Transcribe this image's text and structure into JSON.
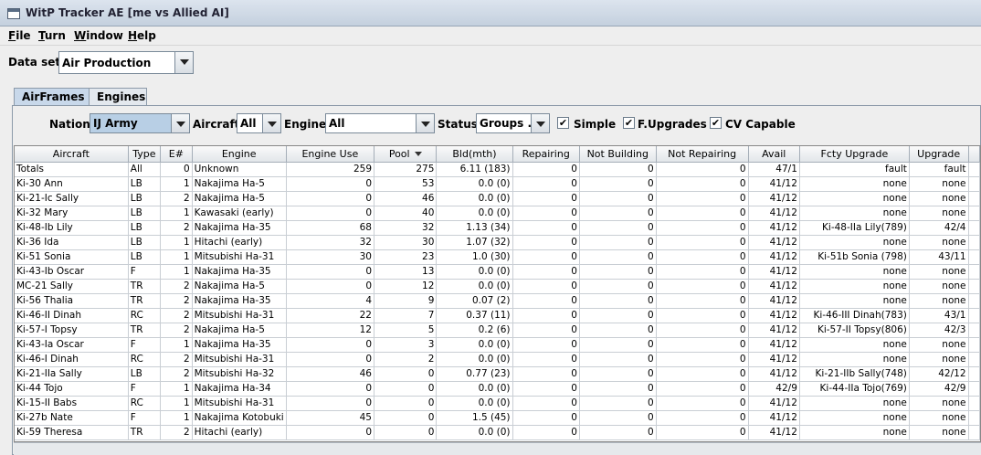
{
  "window": {
    "title": "WitP Tracker AE [me vs Allied AI]"
  },
  "menu": [
    "File",
    "Turn",
    "Window",
    "Help"
  ],
  "dataset": {
    "label": "Data set:",
    "value": "Air Production"
  },
  "tabs": [
    "AirFrames",
    "Engines"
  ],
  "filters": {
    "nation_label": "Nation:",
    "nation_value": "IJ Army",
    "aircraft_label": "Aircraft:",
    "aircraft_value": "All",
    "engine_label": "Engine:",
    "engine_value": "All",
    "status_label": "Status:",
    "status_value": "Groups ...",
    "simple_label": "Simple",
    "fupgrades_label": "F.Upgrades",
    "cv_label": "CV Capable",
    "check_glyph": "✔"
  },
  "table": {
    "columns": [
      "Aircraft",
      "Type",
      "E#",
      "Engine",
      "Engine Use",
      "Pool",
      "Bld(mth)",
      "Repairing",
      "Not Building",
      "Not Repairing",
      "Avail",
      "Fcty Upgrade",
      "Upgrade"
    ],
    "sorted_column": "Pool",
    "rows": [
      [
        "Totals",
        "All",
        "0",
        "Unknown",
        "259",
        "275",
        "6.11 (183)",
        "0",
        "0",
        "0",
        "47/1",
        "fault",
        "fault"
      ],
      [
        "Ki-30 Ann",
        "LB",
        "1",
        "Nakajima Ha-5",
        "0",
        "53",
        "0.0 (0)",
        "0",
        "0",
        "0",
        "41/12",
        "none",
        "none"
      ],
      [
        "Ki-21-Ic Sally",
        "LB",
        "2",
        "Nakajima Ha-5",
        "0",
        "46",
        "0.0 (0)",
        "0",
        "0",
        "0",
        "41/12",
        "none",
        "none"
      ],
      [
        "Ki-32 Mary",
        "LB",
        "1",
        "Kawasaki (early)",
        "0",
        "40",
        "0.0 (0)",
        "0",
        "0",
        "0",
        "41/12",
        "none",
        "none"
      ],
      [
        "Ki-48-Ib Lily",
        "LB",
        "2",
        "Nakajima Ha-35",
        "68",
        "32",
        "1.13 (34)",
        "0",
        "0",
        "0",
        "41/12",
        "Ki-48-IIa Lily(789)",
        "42/4"
      ],
      [
        "Ki-36 Ida",
        "LB",
        "1",
        "Hitachi (early)",
        "32",
        "30",
        "1.07 (32)",
        "0",
        "0",
        "0",
        "41/12",
        "none",
        "none"
      ],
      [
        "Ki-51 Sonia",
        "LB",
        "1",
        "Mitsubishi Ha-31",
        "30",
        "23",
        "1.0 (30)",
        "0",
        "0",
        "0",
        "41/12",
        "Ki-51b Sonia (798)",
        "43/11"
      ],
      [
        "Ki-43-Ib Oscar",
        "F",
        "1",
        "Nakajima Ha-35",
        "0",
        "13",
        "0.0 (0)",
        "0",
        "0",
        "0",
        "41/12",
        "none",
        "none"
      ],
      [
        "MC-21 Sally",
        "TR",
        "2",
        "Nakajima Ha-5",
        "0",
        "12",
        "0.0 (0)",
        "0",
        "0",
        "0",
        "41/12",
        "none",
        "none"
      ],
      [
        "Ki-56 Thalia",
        "TR",
        "2",
        "Nakajima Ha-35",
        "4",
        "9",
        "0.07 (2)",
        "0",
        "0",
        "0",
        "41/12",
        "none",
        "none"
      ],
      [
        "Ki-46-II Dinah",
        "RC",
        "2",
        "Mitsubishi Ha-31",
        "22",
        "7",
        "0.37 (11)",
        "0",
        "0",
        "0",
        "41/12",
        "Ki-46-III Dinah(783)",
        "43/1"
      ],
      [
        "Ki-57-I Topsy",
        "TR",
        "2",
        "Nakajima Ha-5",
        "12",
        "5",
        "0.2 (6)",
        "0",
        "0",
        "0",
        "41/12",
        "Ki-57-II Topsy(806)",
        "42/3"
      ],
      [
        "Ki-43-Ia Oscar",
        "F",
        "1",
        "Nakajima Ha-35",
        "0",
        "3",
        "0.0 (0)",
        "0",
        "0",
        "0",
        "41/12",
        "none",
        "none"
      ],
      [
        "Ki-46-I Dinah",
        "RC",
        "2",
        "Mitsubishi Ha-31",
        "0",
        "2",
        "0.0 (0)",
        "0",
        "0",
        "0",
        "41/12",
        "none",
        "none"
      ],
      [
        "Ki-21-IIa Sally",
        "LB",
        "2",
        "Mitsubishi Ha-32",
        "46",
        "0",
        "0.77 (23)",
        "0",
        "0",
        "0",
        "41/12",
        "Ki-21-IIb Sally(748)",
        "42/12"
      ],
      [
        "Ki-44 Tojo",
        "F",
        "1",
        "Nakajima Ha-34",
        "0",
        "0",
        "0.0 (0)",
        "0",
        "0",
        "0",
        "42/9",
        "Ki-44-IIa Tojo(769)",
        "42/9"
      ],
      [
        "Ki-15-II Babs",
        "RC",
        "1",
        "Mitsubishi Ha-31",
        "0",
        "0",
        "0.0 (0)",
        "0",
        "0",
        "0",
        "41/12",
        "none",
        "none"
      ],
      [
        "Ki-27b Nate",
        "F",
        "1",
        "Nakajima Kotobuki",
        "45",
        "0",
        "1.5 (45)",
        "0",
        "0",
        "0",
        "41/12",
        "none",
        "none"
      ],
      [
        "Ki-59 Theresa",
        "TR",
        "2",
        "Hitachi (early)",
        "0",
        "0",
        "0.0 (0)",
        "0",
        "0",
        "0",
        "41/12",
        "none",
        "none"
      ]
    ]
  }
}
